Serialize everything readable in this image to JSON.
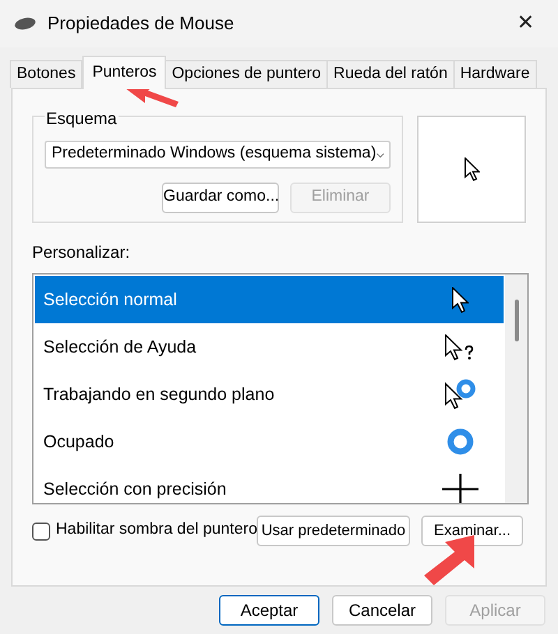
{
  "window": {
    "title": "Propiedades de Mouse",
    "close": "✕"
  },
  "tabs": [
    {
      "label": "Botones",
      "selected": false
    },
    {
      "label": "Punteros",
      "selected": true
    },
    {
      "label": "Opciones de puntero",
      "selected": false
    },
    {
      "label": "Rueda del ratón",
      "selected": false
    },
    {
      "label": "Hardware",
      "selected": false
    }
  ],
  "scheme": {
    "legend": "Esquema",
    "value": "Predeterminado Windows (esquema sistema)",
    "buttons": [
      {
        "label": "Guardar como...",
        "disabled": false
      },
      {
        "label": "Eliminar",
        "disabled": true
      }
    ]
  },
  "customize": {
    "label": "Personalizar:",
    "rows": [
      {
        "name": "Selección normal",
        "kind": "arrow",
        "selected": true
      },
      {
        "name": "Selección de Ayuda",
        "kind": "help",
        "selected": false
      },
      {
        "name": "Trabajando en segundo plano",
        "kind": "working",
        "selected": false
      },
      {
        "name": "Ocupado",
        "kind": "busy",
        "selected": false
      },
      {
        "name": "Selección con precisión",
        "kind": "precision",
        "selected": false
      }
    ]
  },
  "shadow": {
    "label": "Habilitar sombra del puntero",
    "checked": false
  },
  "row_buttons": [
    {
      "label": "Usar predeterminado"
    },
    {
      "label": "Examinar..."
    }
  ],
  "footer_buttons": [
    {
      "label": "Aceptar",
      "default": true,
      "disabled": false
    },
    {
      "label": "Cancelar",
      "default": false,
      "disabled": false
    },
    {
      "label": "Aplicar",
      "default": false,
      "disabled": true
    }
  ]
}
